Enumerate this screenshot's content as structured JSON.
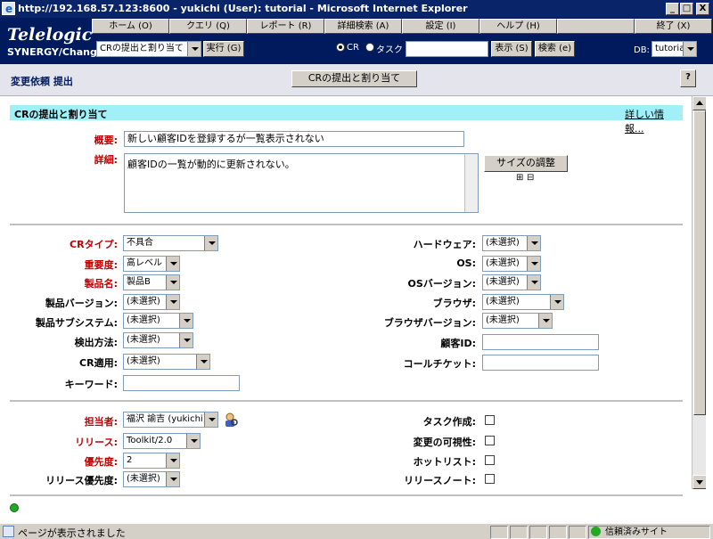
{
  "window": {
    "title": "http://192.168.57.123:8600 - yukichi (User): tutorial - Microsoft Internet Explorer",
    "minimize": "_",
    "maximize": "□",
    "close": "X"
  },
  "brand": {
    "logo": "Telelogic",
    "product": "SYNERGY/Change"
  },
  "nav": [
    "ホーム (O)",
    "クエリ (Q)",
    "レポート (R)",
    "詳細検索 (A)",
    "設定 (I)",
    "ヘルプ (H)",
    "",
    "終了 (X)"
  ],
  "toolbar": {
    "action_select": "CRの提出と割り当て",
    "run_button": "実行 (G)",
    "radio_cr": "CR",
    "radio_task": "タスク",
    "search_value": "",
    "show_button": "表示 (S)",
    "search_button": "検索 (e)",
    "db_label": "DB:",
    "db_select": "tutorial"
  },
  "subheader": {
    "breadcrumb": "変更依頼 提出",
    "submit_button": "CRの提出と割り当て",
    "help_button": "?"
  },
  "section": {
    "title": "CRの提出と割り当て",
    "details_link": "詳しい情報..."
  },
  "summary": {
    "label": "概要:",
    "value": "新しい顧客IDを登録するが一覧表示されない"
  },
  "detail": {
    "label": "詳細:",
    "value": "顧客IDの一覧が動的に更新されない。",
    "resize_button": "サイズの調整",
    "expand": "⊞",
    "collapse": "⊟"
  },
  "left_fields": [
    {
      "label": "CRタイプ:",
      "value": "不具合",
      "required": true
    },
    {
      "label": "重要度:",
      "value": "高レベル",
      "required": true
    },
    {
      "label": "製品名:",
      "value": "製品B",
      "required": true
    },
    {
      "label": "製品バージョン:",
      "value": "(未選択)",
      "required": false
    },
    {
      "label": "製品サブシステム:",
      "value": "(未選択)",
      "required": false
    },
    {
      "label": "検出方法:",
      "value": "(未選択)",
      "required": false
    },
    {
      "label": "CR適用:",
      "value": "(未選択)",
      "required": false
    },
    {
      "label": "キーワード:",
      "value": "",
      "required": false
    }
  ],
  "right_fields": [
    {
      "label": "ハードウェア:",
      "value": "(未選択)"
    },
    {
      "label": "OS:",
      "value": "(未選択)"
    },
    {
      "label": "OSバージョン:",
      "value": "(未選択)"
    },
    {
      "label": "ブラウザ:",
      "value": "(未選択)"
    },
    {
      "label": "ブラウザバージョン:",
      "value": "(未選択)"
    },
    {
      "label": "顧客ID:",
      "value": ""
    },
    {
      "label": "コールチケット:",
      "value": ""
    }
  ],
  "assign_fields": [
    {
      "label": "担当者:",
      "value": "福沢 諭吉 (yukichi)",
      "required": true
    },
    {
      "label": "リリース:",
      "value": "Toolkit/2.0",
      "required": true
    },
    {
      "label": "優先度:",
      "value": "2",
      "required": true
    },
    {
      "label": "リリース優先度:",
      "value": "(未選択)",
      "required": false
    }
  ],
  "checkbox_fields": [
    {
      "label": "タスク作成:",
      "checked": false
    },
    {
      "label": "変更の可視性:",
      "checked": false
    },
    {
      "label": "ホットリスト:",
      "checked": false
    },
    {
      "label": "リリースノート:",
      "checked": false
    }
  ],
  "status": {
    "text": "ページが表示されました",
    "zone": "信頼済みサイト"
  },
  "colors": {
    "header": "#001a5e",
    "section_bar": "#9ff0f8",
    "required": "#c00000"
  }
}
